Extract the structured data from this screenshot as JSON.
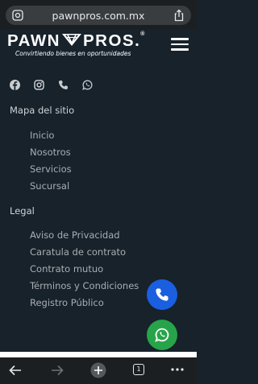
{
  "browser": {
    "url": "pawnpros.com.mx",
    "tab_count": "1"
  },
  "header": {
    "logo_left": "PAWN",
    "logo_right": "PROS.",
    "logo_reg": "®",
    "tagline": "Convirtiendo bienes en oportunidades"
  },
  "social_icons": [
    "facebook-icon",
    "instagram-icon",
    "phone-icon",
    "whatsapp-icon"
  ],
  "sitemap": {
    "title": "Mapa del sitio",
    "links": [
      "Inicio",
      "Nosotros",
      "Servicios",
      "Sucursal"
    ]
  },
  "legal": {
    "title": "Legal",
    "links": [
      "Aviso de Privacidad",
      "Caratula de contrato",
      "Contrato mutuo",
      "Términos y Condiciones",
      "Registro Público"
    ]
  },
  "colors": {
    "background": "#17222b",
    "call_button": "#1a5fe0",
    "whatsapp_button": "#27a44a"
  }
}
